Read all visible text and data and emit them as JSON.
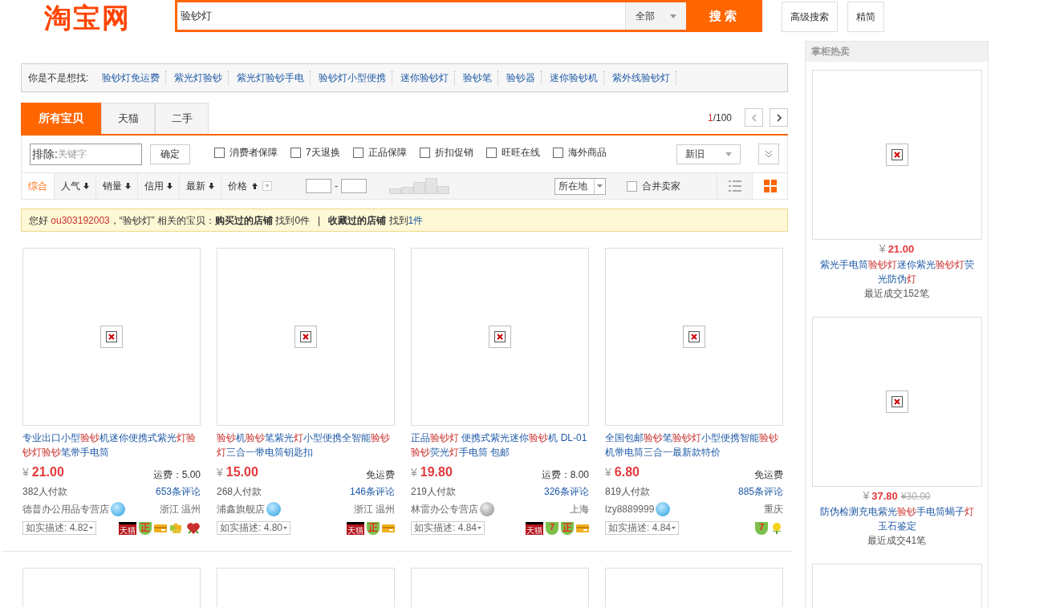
{
  "header": {
    "logo": "淘宝网",
    "search_value": "验钞灯",
    "scope": "全部",
    "search_button": "搜 索",
    "buttons": [
      "高级搜索",
      "精简"
    ]
  },
  "suggestions": {
    "label": "你是不是想找:",
    "items": [
      "验钞灯免运费",
      "紫光灯验钞",
      "紫光灯验钞手电",
      "验钞灯小型便携",
      "迷你验钞灯",
      "验钞笔",
      "验钞器",
      "迷你验钞机",
      "紫外线验钞灯"
    ]
  },
  "tabs": [
    {
      "label": "所有宝贝",
      "selected": true
    },
    {
      "label": "天猫",
      "selected": false
    },
    {
      "label": "二手",
      "selected": false
    }
  ],
  "pager": {
    "current": "1",
    "total": "/100"
  },
  "filters": {
    "exclude_label": "排除:",
    "placeholder": "关键字",
    "confirm": "确定",
    "checkboxes": [
      {
        "label": "消费者保障",
        "checked": false
      },
      {
        "label": "7天退换",
        "checked": false
      },
      {
        "label": "正品保障",
        "checked": false
      },
      {
        "label": "折扣促销",
        "checked": false
      },
      {
        "label": "旺旺在线",
        "checked": false
      },
      {
        "label": "海外商品",
        "checked": false
      }
    ],
    "condition": "新旧"
  },
  "sort": {
    "items": [
      {
        "label": "综合",
        "selected": true,
        "arrow": false
      },
      {
        "label": "人气",
        "selected": false,
        "arrow": true
      },
      {
        "label": "销量",
        "selected": false,
        "arrow": true
      },
      {
        "label": "信用",
        "selected": false,
        "arrow": true
      },
      {
        "label": "最新",
        "selected": false,
        "arrow": true
      }
    ],
    "price_label": "价格",
    "range_separator": "-",
    "location": "所在地",
    "merge": {
      "label": "合并卖家",
      "checked": false
    },
    "views": [
      {
        "kind": "list",
        "selected": false
      },
      {
        "kind": "grid",
        "selected": true
      }
    ]
  },
  "notice": [
    {
      "kind": "plain",
      "text": "您好 "
    },
    {
      "kind": "user",
      "text": "ou303192003"
    },
    {
      "kind": "plain",
      "text": "，“验钞灯” 相关的宝贝："
    },
    {
      "kind": "bold",
      "text": "购买过的店铺"
    },
    {
      "kind": "plain",
      "text": " 找到0件"
    },
    {
      "kind": "sep",
      "text": "|"
    },
    {
      "kind": "bold",
      "text": "收藏过的店铺"
    },
    {
      "kind": "plain",
      "text": " 找到"
    },
    {
      "kind": "link",
      "text": "1件"
    }
  ],
  "products": [
    {
      "title": [
        {
          "text": "专业出口小型",
          "hl": false
        },
        {
          "text": "验钞",
          "hl": true
        },
        {
          "text": "机迷你便携式紫光",
          "hl": false
        },
        {
          "text": "灯验钞灯验钞",
          "hl": true
        },
        {
          "text": "笔带手电筒",
          "hl": false
        }
      ],
      "price": "21.00",
      "shipping": "运费：5.00",
      "paid": "382人付款",
      "reviews": "653条评论",
      "shop": "德普办公用品专营店",
      "online": true,
      "location": "浙江 温州",
      "rating": "如实描述: 4.82",
      "badges": [
        {
          "kind": "tmall",
          "label": "天猫"
        },
        {
          "kind": "genuine",
          "label": "正"
        },
        {
          "kind": "card"
        },
        {
          "kind": "puzzle"
        },
        {
          "kind": "heart"
        }
      ]
    },
    {
      "title": [
        {
          "text": "验钞",
          "hl": true
        },
        {
          "text": "机",
          "hl": false
        },
        {
          "text": "验钞",
          "hl": true
        },
        {
          "text": "笔紫光",
          "hl": false
        },
        {
          "text": "灯",
          "hl": true
        },
        {
          "text": "小型便携全智能",
          "hl": false
        },
        {
          "text": "验钞灯",
          "hl": true
        },
        {
          "text": "三合一带电筒钥匙扣",
          "hl": false
        }
      ],
      "price": "15.00",
      "shipping": "免运费",
      "paid": "268人付款",
      "reviews": "146条评论",
      "shop": "浦鑫旗舰店",
      "online": true,
      "location": "浙江 温州",
      "rating": "如实描述: 4.80",
      "badges": [
        {
          "kind": "tmall",
          "label": "天猫"
        },
        {
          "kind": "genuine",
          "label": "正"
        },
        {
          "kind": "card"
        }
      ]
    },
    {
      "title": [
        {
          "text": "正品",
          "hl": false
        },
        {
          "text": "验钞灯",
          "hl": true
        },
        {
          "text": " 便携式紫光迷你",
          "hl": false
        },
        {
          "text": "验钞",
          "hl": true
        },
        {
          "text": "机 DL-01 ",
          "hl": false
        },
        {
          "text": "验钞",
          "hl": true
        },
        {
          "text": "荧光",
          "hl": false
        },
        {
          "text": "灯",
          "hl": true
        },
        {
          "text": "手电筒 包邮",
          "hl": false
        }
      ],
      "price": "19.80",
      "shipping": "运费：8.00",
      "paid": "219人付款",
      "reviews": "326条评论",
      "shop": "林雷办公专营店",
      "online": false,
      "location": "上海",
      "rating": "如实描述: 4.84",
      "badges": [
        {
          "kind": "tmall",
          "label": "天猫"
        },
        {
          "kind": "seven",
          "label": "7"
        },
        {
          "kind": "genuine",
          "label": "正"
        },
        {
          "kind": "card"
        }
      ]
    },
    {
      "title": [
        {
          "text": "全国包邮",
          "hl": false
        },
        {
          "text": "验钞",
          "hl": true
        },
        {
          "text": "笔",
          "hl": false
        },
        {
          "text": "验钞灯",
          "hl": true
        },
        {
          "text": "小型便携智能",
          "hl": false
        },
        {
          "text": "验钞",
          "hl": true
        },
        {
          "text": "机带电筒三合一最新款特价",
          "hl": false
        }
      ],
      "price": "6.80",
      "shipping": "免运费",
      "paid": "819人付款",
      "reviews": "885条评论",
      "shop": "lzy8889999",
      "online": true,
      "location": "重庆",
      "rating": "如实描述: 4.84",
      "badges": [
        {
          "kind": "seven",
          "label": "7"
        },
        {
          "kind": "flower"
        }
      ]
    }
  ],
  "next_row": [
    {
      "kind": "image-box"
    },
    {
      "kind": "image-box"
    },
    {
      "kind": "image-box"
    },
    {
      "kind": "image-box"
    }
  ],
  "currency": "¥",
  "sidebar": {
    "title": "掌柜热卖",
    "items": [
      {
        "price": "21.00",
        "title": [
          {
            "text": "紫光手电筒",
            "hl": false
          },
          {
            "text": "验钞灯",
            "hl": true
          },
          {
            "text": "迷你紫光",
            "hl": false
          },
          {
            "text": "验钞灯",
            "hl": true
          },
          {
            "text": "荧光防伪",
            "hl": false
          },
          {
            "text": "灯",
            "hl": true
          }
        ],
        "sales": "最近成交152笔"
      },
      {
        "price": "37.80",
        "old_price": "¥30.00",
        "title": [
          {
            "text": "防伪检测充电紫光",
            "hl": false
          },
          {
            "text": "验钞",
            "hl": true
          },
          {
            "text": "手电筒蝎子",
            "hl": false
          },
          {
            "text": "灯",
            "hl": true
          },
          {
            "text": "玉石鉴定",
            "hl": false
          }
        ],
        "sales": "最近成交41笔"
      },
      {
        "kind": "image-box"
      }
    ]
  }
}
